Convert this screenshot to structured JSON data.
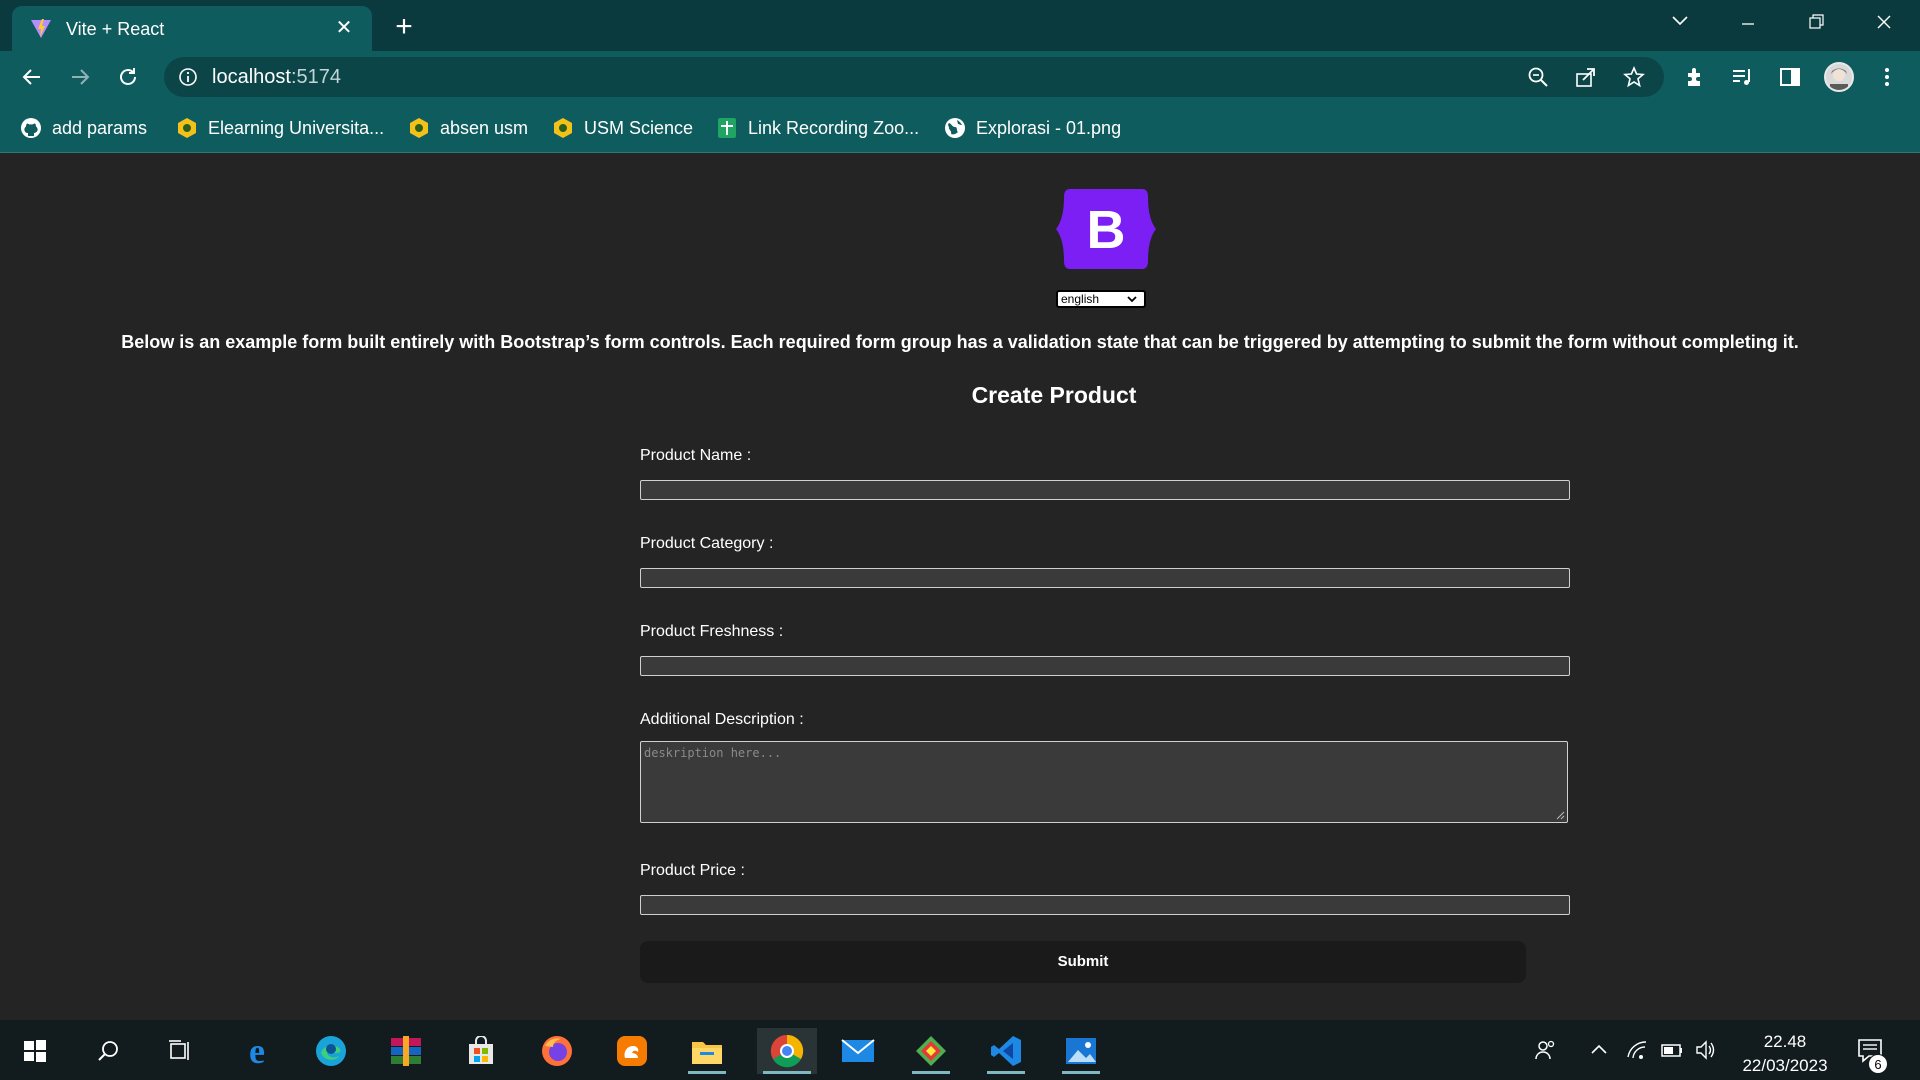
{
  "browser": {
    "tab_title": "Vite + React",
    "url_host": "localhost",
    "url_port": ":5174",
    "bookmarks": [
      {
        "label": "add params",
        "icon": "github-icon"
      },
      {
        "label": "Elearning Universita...",
        "icon": "usm-logo-icon"
      },
      {
        "label": "absen usm",
        "icon": "usm-logo-icon"
      },
      {
        "label": "USM Science",
        "icon": "usm-logo-icon"
      },
      {
        "label": "Link Recording Zoo...",
        "icon": "sheets-icon"
      },
      {
        "label": "Explorasi - 01.png",
        "icon": "globe-icon"
      }
    ]
  },
  "page": {
    "logo_letter": "B",
    "language": "english",
    "intro": "Below is an example form built entirely with Bootstrap’s form controls. Each required form group has a validation state that can be triggered by attempting to submit the form without completing it.",
    "form_title": "Create Product",
    "fields": {
      "name_label": "Product Name :",
      "category_label": "Product Category :",
      "freshness_label": "Product Freshness :",
      "description_label": "Additional Description :",
      "description_placeholder": "deskription here...",
      "price_label": "Product Price :"
    },
    "submit_label": "Submit"
  },
  "taskbar": {
    "time": "22.48",
    "date": "22/03/2023",
    "notification_count": "6"
  },
  "colors": {
    "chrome_dark": "#0b3a3e",
    "chrome": "#0f5c5f",
    "page_bg": "#242424",
    "bootstrap_purple": "#7c1ff5"
  }
}
